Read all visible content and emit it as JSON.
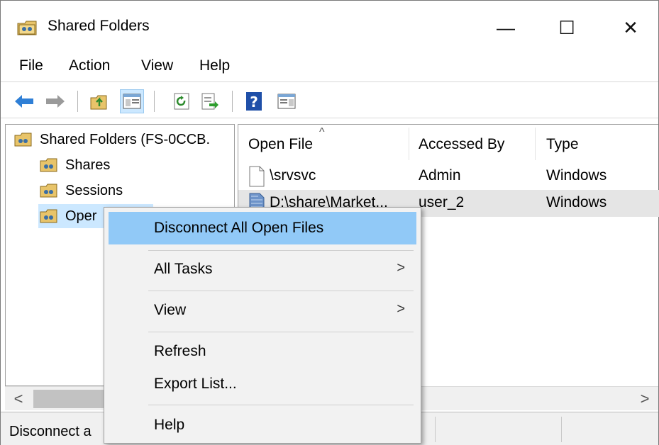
{
  "window": {
    "title": "Shared Folders",
    "minimize_glyph": "—",
    "maximize_glyph": "☐",
    "close_glyph": "✕"
  },
  "menu": [
    "File",
    "Action",
    "View",
    "Help"
  ],
  "toolbar": {
    "icons": [
      "back-arrow-icon",
      "forward-arrow-icon",
      "up-folder-icon",
      "show-hide-tree-icon",
      "refresh-icon",
      "export-list-icon",
      "help-icon",
      "show-hide-action-pane-icon"
    ]
  },
  "tree": {
    "root": "Shared Folders (FS-0CCB.",
    "children": [
      "Shares",
      "Sessions",
      "Open Files"
    ],
    "selected_visible_label": "Oper"
  },
  "list": {
    "columns": [
      "Open File",
      "Accessed By",
      "Type"
    ],
    "rows": [
      {
        "open_file": "\\srvsvc",
        "accessed_by": "Admin",
        "type": "Windows"
      },
      {
        "open_file": "D:\\share\\Market...",
        "accessed_by": "user_2",
        "type": "Windows"
      }
    ]
  },
  "scroll": {
    "left": "<",
    "right": ">"
  },
  "status": {
    "text": "Disconnect a"
  },
  "context_menu": {
    "items": [
      {
        "label": "Disconnect All Open Files",
        "highlighted": true,
        "submenu": false
      },
      {
        "label": "All Tasks",
        "highlighted": false,
        "submenu": true
      },
      {
        "label": "View",
        "highlighted": false,
        "submenu": true
      },
      {
        "label": "Refresh",
        "highlighted": false,
        "submenu": false
      },
      {
        "label": "Export List...",
        "highlighted": false,
        "submenu": false
      },
      {
        "label": "Help",
        "highlighted": false,
        "submenu": false
      }
    ],
    "submenu_glyph": ">"
  },
  "colors": {
    "highlight": "#91c9f7",
    "selection": "#cce8ff",
    "row_selected": "#e5e5e5",
    "menu_bg": "#f2f2f2"
  }
}
